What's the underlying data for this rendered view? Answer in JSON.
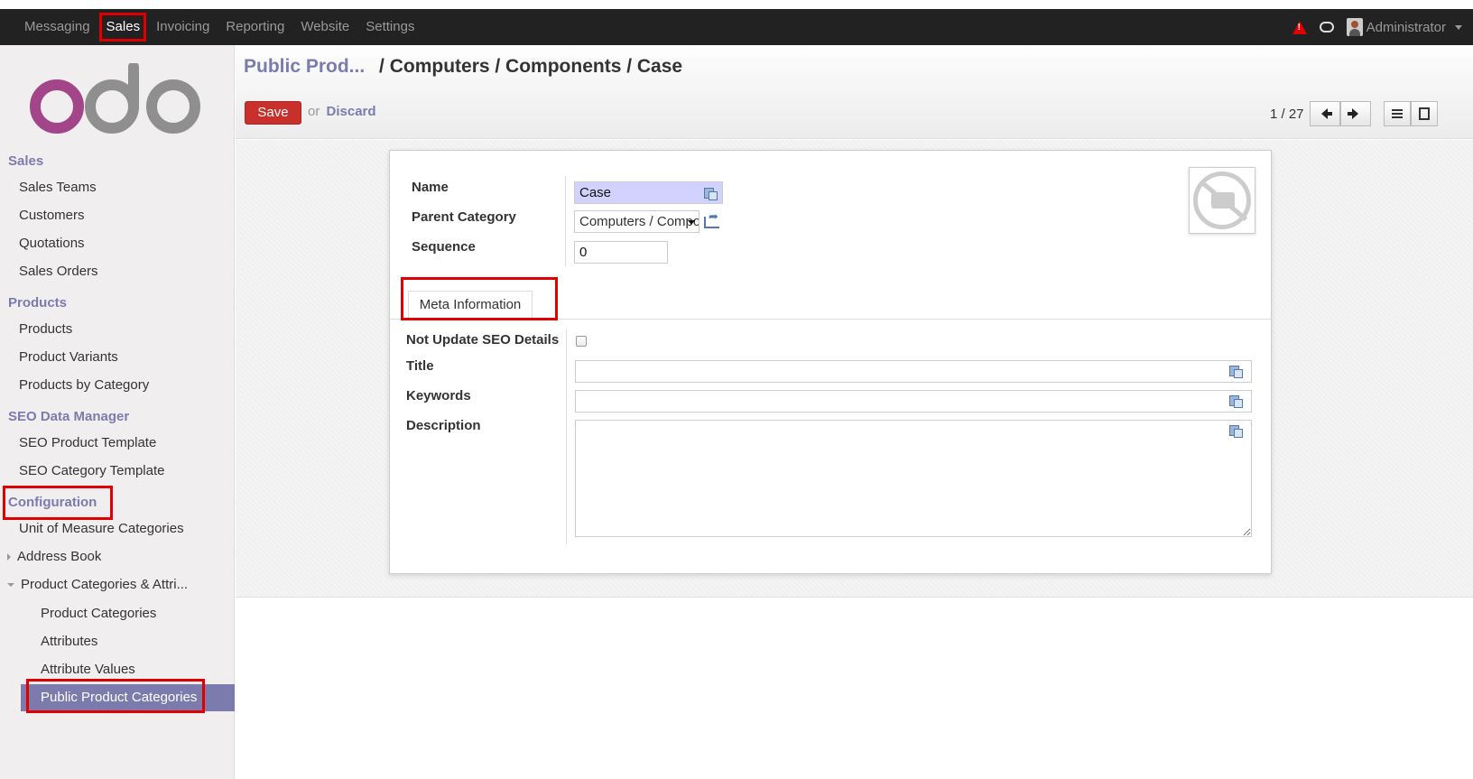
{
  "topbar": {
    "menu": [
      "Messaging",
      "Sales",
      "Invoicing",
      "Reporting",
      "Website",
      "Settings"
    ],
    "active": "Sales",
    "user": "Administrator"
  },
  "sidebar": {
    "logo_text": "odoo",
    "sections": [
      {
        "title": "Sales",
        "items": [
          "Sales Teams",
          "Customers",
          "Quotations",
          "Sales Orders"
        ]
      },
      {
        "title": "Products",
        "items": [
          "Products",
          "Product Variants",
          "Products by Category"
        ]
      },
      {
        "title": "SEO Data Manager",
        "items": [
          "SEO Product Template",
          "SEO Category Template"
        ]
      },
      {
        "title": "Configuration",
        "items": [
          "Unit of Measure Categories",
          "Address Book",
          "Product Categories & Attri...",
          "Product Categories",
          "Attributes",
          "Attribute Values",
          "Public Product Categories"
        ]
      }
    ]
  },
  "breadcrumb": {
    "link": "Public Prod...",
    "path": "/ Computers / Components / Case"
  },
  "buttons": {
    "save": "Save",
    "or": "or",
    "discard": "Discard"
  },
  "pager": {
    "text": "1 / 27"
  },
  "form": {
    "name_label": "Name",
    "name_value": "Case",
    "parent_label": "Parent Category",
    "parent_value": "Computers / Components",
    "sequence_label": "Sequence",
    "sequence_value": "0",
    "tab_label": "Meta Information",
    "seo_label": "Not Update SEO Details",
    "title_label": "Title",
    "keywords_label": "Keywords",
    "description_label": "Description"
  },
  "colors": {
    "accent": "#7c7bad",
    "topbar": "#222222",
    "save": "#c9302c",
    "highlight": "#e00000"
  }
}
